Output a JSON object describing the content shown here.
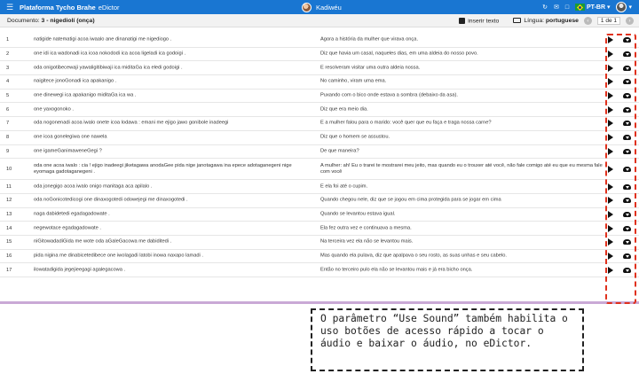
{
  "topbar": {
    "menu_icon": "hamburger-icon",
    "brand": "Plataforma Tycho Brahe",
    "app": "eDictor",
    "project": "Kadiwéu",
    "language": "PT-BR",
    "icons": [
      "refresh-icon",
      "mail-icon",
      "window-icon",
      "flag-br-icon",
      "user-avatar-icon"
    ]
  },
  "subbar": {
    "doc_label": "Documento:",
    "doc_title": "3 - nigediolí (onça)",
    "insert_text": "inserir texto",
    "language_label": "Língua:",
    "language_value": "portuguese",
    "pager": "1 de 1"
  },
  "rows": [
    {
      "n": "1",
      "src": "natigide natematigi acoa iwaalo ane dinanatigi me nigediogo .",
      "tr": "Agora a história da mulher que virava onça."
    },
    {
      "n": "2",
      "src": "one idi ica wadonadi ica icoa nokododi ica acoa ligeladi ica godoigi .",
      "tr": "Diz que havia um casal, naqueles dias, em uma aldeia do nosso povo."
    },
    {
      "n": "3",
      "src": "oda onigotibecewaji yawaligitibiwaji ica miditaGa ica eledi godoigi .",
      "tr": "E resolveram visitar uma outra aldeia nossa."
    },
    {
      "n": "4",
      "src": "naigitece jonoGonadi ica apakanigo .",
      "tr": "No caminho, viram uma ema."
    },
    {
      "n": "5",
      "src": "one dinewegi ica apakanigo miditaGa ica wa .",
      "tr": "Puxando com o bico onde estava a sombra (debaixo da asa)."
    },
    {
      "n": "6",
      "src": "one yaxogonoko .",
      "tr": "Diz que era meio dia."
    },
    {
      "n": "7",
      "src": "oda nogonenadi acoa iwalo onete icoa lodawa : emani me ejigo jawo gonibole inadeegi",
      "tr": "E a mulher falou para o marido: você quer que eu faça e traga nossa carne?"
    },
    {
      "n": "8",
      "src": "one icoa gonelegiwa one nawela",
      "tr": "Diz que o homem se assustou."
    },
    {
      "n": "9",
      "src": "one igameGanimaweneGegi ?",
      "tr": "De que maneira?"
    },
    {
      "n": "10",
      "src": "oda one acoa iwalo : cia ! ejigo inadeegi jiketagawa anodaGee pida nige janotagawa ina epece adotaganegeni nige eyomaga gadotaganegeni .",
      "tr": "A mulher: ah! Eu o trarei te mostrarei meu jeito, mas quando eu o trouxer até você, não fale comigo até eu que eu mesma fale com você",
      "tall": true
    },
    {
      "n": "11",
      "src": "oda jonegigo acoa iwalo onigo manitaga aca apilalo .",
      "tr": "E ela foi até o cupim."
    },
    {
      "n": "12",
      "src": "oda noGonicotedicogi one dinaxogotedi odowejegi me dinaxogotedi .",
      "tr": "Quando chegou nele, diz que se jogou em cima protegida para se jogar em cima"
    },
    {
      "n": "13",
      "src": "naga dabidetedi egadagadowate .",
      "tr": "Quando se levantou estava igual."
    },
    {
      "n": "14",
      "src": "negewotace egadagadowate .",
      "tr": "Ela fez outra vez e continuava a mesma."
    },
    {
      "n": "15",
      "src": "niGitowadadiGida me wote oda aGaleGacowa me dabiditedi .",
      "tr": "Na terceira vez ela não se levantou mais."
    },
    {
      "n": "16",
      "src": "pida nigina me dinabicetedibece one iwolagadi latobi inowa naxapo lamadi .",
      "tr": "Mas quando ela pulava, diz que apalpava o seu rosto, as suas unhas e seu cabelo."
    },
    {
      "n": "17",
      "src": "ilowatadigida jegejieegagi agalegacowa .",
      "tr": "Então no terceiro pulo ela não se levantou mais e já era bicho onça."
    }
  ],
  "row_icons": {
    "play": "play-icon",
    "download": "cloud-download-icon"
  },
  "callout": "O parâmetro “Use Sound” também habilita o uso botões de acesso rápido a tocar o áudio e baixar o áudio, no eDictor.",
  "colors": {
    "topbar": "#1976d2",
    "highlight": "#e0311d",
    "accent_line": "#c9a9d6"
  }
}
